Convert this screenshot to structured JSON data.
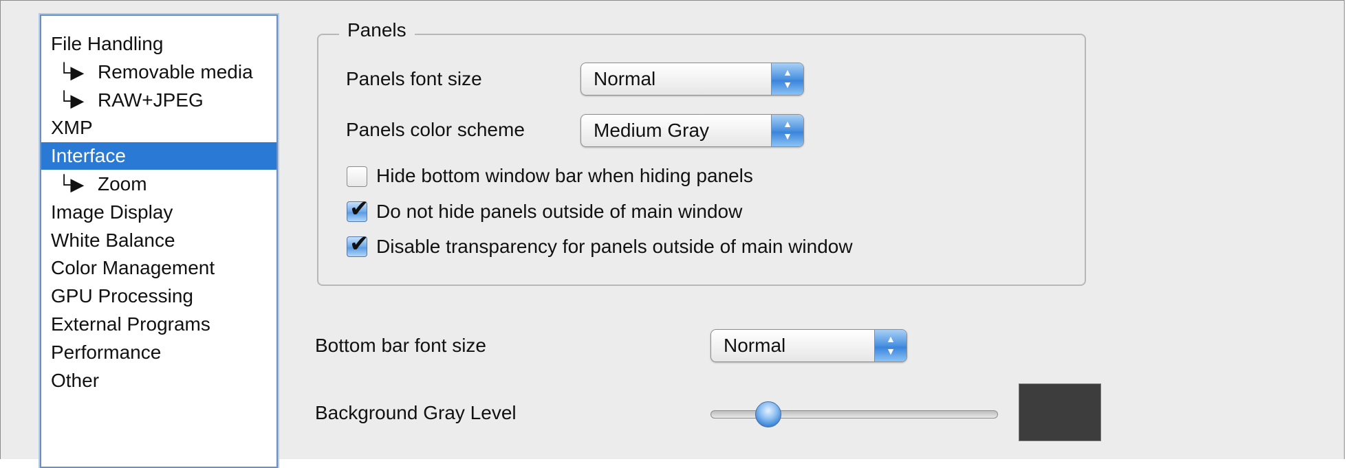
{
  "sidebar": {
    "items": [
      {
        "label": "File Handling",
        "sub": false,
        "selected": false
      },
      {
        "label": "Removable media",
        "sub": true,
        "selected": false
      },
      {
        "label": "RAW+JPEG",
        "sub": true,
        "selected": false
      },
      {
        "label": "XMP",
        "sub": false,
        "selected": false
      },
      {
        "label": "Interface",
        "sub": false,
        "selected": true
      },
      {
        "label": "Zoom",
        "sub": true,
        "selected": false
      },
      {
        "label": "Image Display",
        "sub": false,
        "selected": false
      },
      {
        "label": "White Balance",
        "sub": false,
        "selected": false
      },
      {
        "label": "Color Management",
        "sub": false,
        "selected": false
      },
      {
        "label": "GPU Processing",
        "sub": false,
        "selected": false
      },
      {
        "label": "External Programs",
        "sub": false,
        "selected": false
      },
      {
        "label": "Performance",
        "sub": false,
        "selected": false
      },
      {
        "label": "Other",
        "sub": false,
        "selected": false
      }
    ],
    "sub_arrow": "└▶"
  },
  "panels": {
    "title": "Panels",
    "font_size_label": "Panels font size",
    "font_size_value": "Normal",
    "color_scheme_label": "Panels color scheme",
    "color_scheme_value": "Medium Gray",
    "checkboxes": [
      {
        "label": "Hide bottom window bar when hiding panels",
        "checked": false
      },
      {
        "label": "Do not hide panels outside of main window",
        "checked": true
      },
      {
        "label": "Disable transparency for panels outside of main window",
        "checked": true
      }
    ]
  },
  "bottom_bar": {
    "font_size_label": "Bottom bar font size",
    "font_size_value": "Normal"
  },
  "background": {
    "label": "Background Gray Level",
    "slider_fraction": 0.17,
    "swatch_color": "#3d3d3d"
  },
  "colors": {
    "selection": "#2a7ad5",
    "accent": "#4a91e0"
  },
  "icons": {
    "stepper": "up-down-arrows-icon",
    "check": "checkmark-icon"
  }
}
